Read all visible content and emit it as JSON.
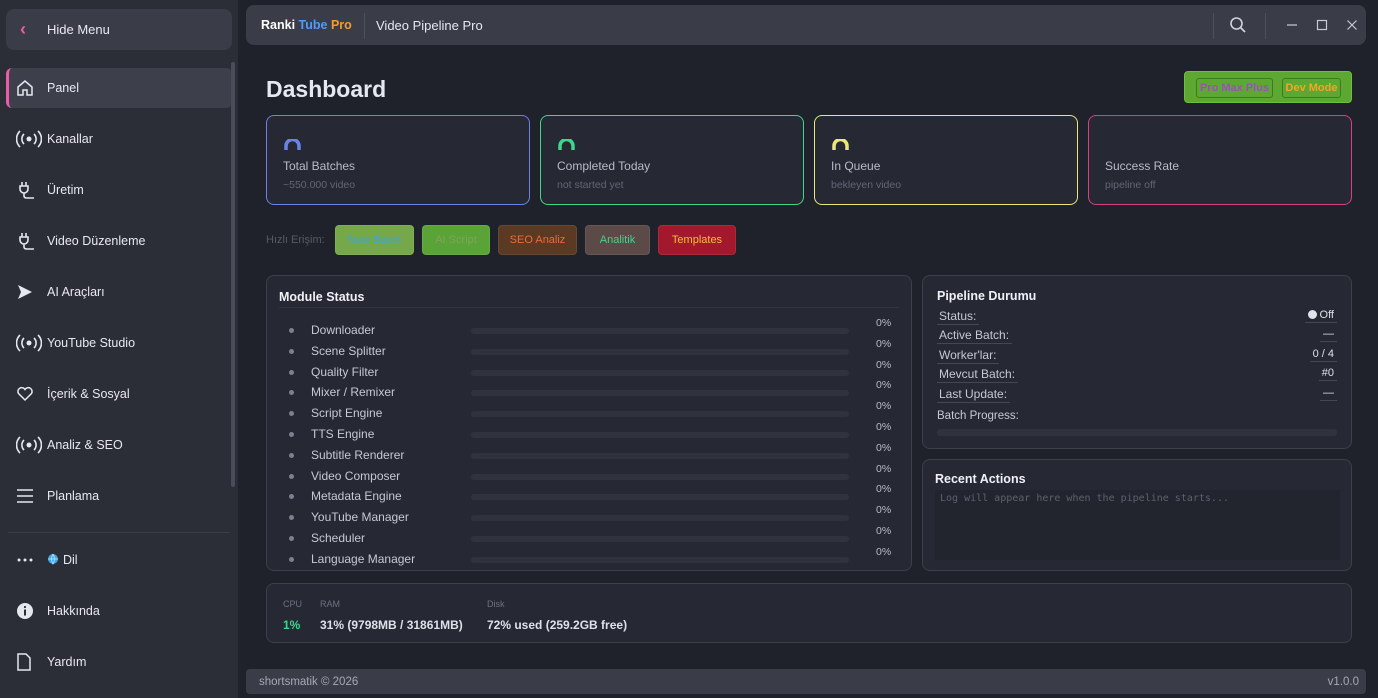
{
  "sidebar": {
    "hide_menu": "Hide Menu",
    "items": [
      {
        "label": "Panel",
        "icon": "home-icon"
      },
      {
        "label": "Kanallar",
        "icon": "broadcast-icon"
      },
      {
        "label": "Üretim",
        "icon": "plug-icon"
      },
      {
        "label": "Video Düzenleme",
        "icon": "plug-icon"
      },
      {
        "label": "AI Araçları",
        "icon": "send-icon"
      },
      {
        "label": "YouTube Studio",
        "icon": "broadcast-icon"
      },
      {
        "label": "İçerik & Sosyal",
        "icon": "heart-icon"
      },
      {
        "label": "Analiz & SEO",
        "icon": "broadcast-icon"
      },
      {
        "label": "Planlama",
        "icon": "menu-icon"
      }
    ],
    "bottom": [
      {
        "label": "Dil",
        "icon": "more-icon"
      },
      {
        "label": "Hakkında",
        "icon": "info-icon"
      },
      {
        "label": "Yardım",
        "icon": "document-icon"
      }
    ]
  },
  "topbar": {
    "brand_part1": "Ranki",
    "brand_part2": "Tube",
    "brand_part3": "Pro",
    "title": "Video Pipeline Pro"
  },
  "dashboard": {
    "title": "Dashboard",
    "mode_buttons": [
      "Pro Max Plus",
      "Dev Mode"
    ],
    "stats": [
      {
        "label": "Total Batches",
        "sub": "~550.000 video",
        "color": "#6b82e6",
        "gauge_color": "#6b82e6"
      },
      {
        "label": "Completed Today",
        "sub": "not started yet",
        "color": "#3fd68a",
        "gauge_color": "#3fd68a"
      },
      {
        "label": "In Queue",
        "sub": "bekleyen video",
        "color": "#e9e77a",
        "gauge_color": "#e9e77a"
      },
      {
        "label": "Success Rate",
        "sub": "pipeline off",
        "color": "#d63f86",
        "gauge_color": ""
      }
    ],
    "quick_access_label": "Hızlı Erişim:",
    "quick_buttons": [
      {
        "label": "New Batch",
        "bg": "#76a84a",
        "fg": "#3ea4e0"
      },
      {
        "label": "AI Script",
        "bg": "#5aa336",
        "fg": "#7fa25e"
      },
      {
        "label": "SEO Analiz",
        "bg": "#5a3a22",
        "fg": "#ef6a3a"
      },
      {
        "label": "Analitik",
        "bg": "#5b4a48",
        "fg": "#3fd68a"
      },
      {
        "label": "Templates",
        "bg": "#a3182c",
        "fg": "#f4c037"
      }
    ]
  },
  "module_status": {
    "title": "Module Status",
    "modules": [
      {
        "name": "Downloader",
        "pct": "0%",
        "value": 0
      },
      {
        "name": "Scene Splitter",
        "pct": "0%",
        "value": 0
      },
      {
        "name": "Quality Filter",
        "pct": "0%",
        "value": 0
      },
      {
        "name": "Mixer / Remixer",
        "pct": "0%",
        "value": 0
      },
      {
        "name": "Script Engine",
        "pct": "0%",
        "value": 0
      },
      {
        "name": "TTS Engine",
        "pct": "0%",
        "value": 0
      },
      {
        "name": "Subtitle Renderer",
        "pct": "0%",
        "value": 0
      },
      {
        "name": "Video Composer",
        "pct": "0%",
        "value": 0
      },
      {
        "name": "Metadata Engine",
        "pct": "0%",
        "value": 0
      },
      {
        "name": "YouTube Manager",
        "pct": "0%",
        "value": 0
      },
      {
        "name": "Scheduler",
        "pct": "0%",
        "value": 0
      },
      {
        "name": "Language Manager",
        "pct": "0%",
        "value": 0
      }
    ]
  },
  "pipeline": {
    "title": "Pipeline Durumu",
    "rows": [
      {
        "key": "Status:",
        "value": "Off"
      },
      {
        "key": "Active Batch:",
        "value": "—"
      },
      {
        "key": "Worker'lar:",
        "value": "0 / 4"
      },
      {
        "key": "Mevcut Batch:",
        "value": "#0"
      },
      {
        "key": "Last Update:",
        "value": "—"
      }
    ],
    "progress_label": "Batch Progress:",
    "progress": 0
  },
  "recent": {
    "title": "Recent Actions",
    "placeholder": "Log will appear here when the pipeline starts..."
  },
  "system": {
    "cpu_label": "CPU",
    "cpu_value": "1%",
    "ram_label": "RAM",
    "ram_value": "31% (9798MB / 31861MB)",
    "disk_label": "Disk",
    "disk_value": "72% used  (259.2GB free)"
  },
  "footer": {
    "left": "shortsmatik © 2026",
    "right": "v1.0.0"
  }
}
